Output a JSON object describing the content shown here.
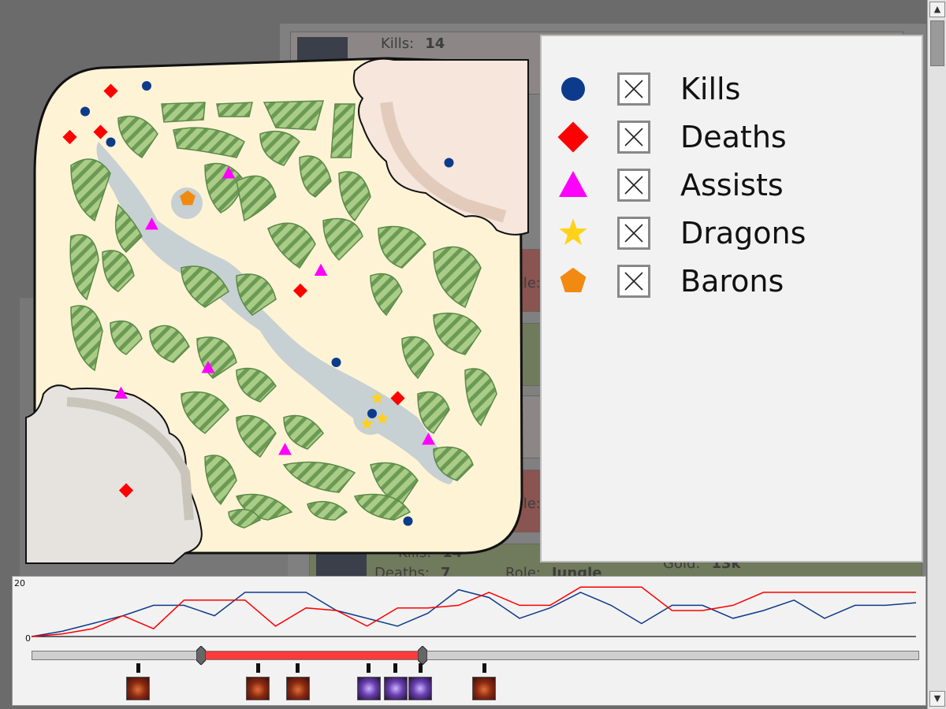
{
  "background_cards": [
    {
      "kills_label": "Kills:",
      "kills": "14",
      "deaths_label": "Deaths:",
      "deaths": "7",
      "role_label": "Role:",
      "role": "Jungle",
      "gold_label": "Gold:",
      "gold": "13k"
    }
  ],
  "legend": {
    "items": [
      {
        "label": "Kills",
        "symbol": "circle",
        "color": "#0d3b8c",
        "checked": true
      },
      {
        "label": "Deaths",
        "symbol": "diamond",
        "color": "#ff0000",
        "checked": true
      },
      {
        "label": "Assists",
        "symbol": "triangle",
        "color": "#ff00ff",
        "checked": true
      },
      {
        "label": "Dragons",
        "symbol": "star",
        "color": "#ffd21a",
        "checked": true
      },
      {
        "label": "Barons",
        "symbol": "pentagon",
        "color": "#f28a12",
        "checked": true
      }
    ]
  },
  "timeline": {
    "y_max_label": "20",
    "y_min_label": "0",
    "range_start": 0.19,
    "range_end": 0.44,
    "events": [
      {
        "type": "fire",
        "position": 0.12
      },
      {
        "type": "fire",
        "position": 0.255
      },
      {
        "type": "fire",
        "position": 0.3
      },
      {
        "type": "void",
        "position": 0.38
      },
      {
        "type": "void",
        "position": 0.41
      },
      {
        "type": "void",
        "position": 0.438
      },
      {
        "type": "fire",
        "position": 0.51
      }
    ]
  },
  "chart_data": {
    "type": "line",
    "ylim": [
      0,
      20
    ],
    "x": [
      0,
      1,
      2,
      3,
      4,
      5,
      6,
      7,
      8,
      9,
      10,
      11,
      12,
      13,
      14,
      15,
      16,
      17,
      18,
      19,
      20,
      21,
      22,
      23,
      24,
      25,
      26,
      27,
      28,
      29
    ],
    "series": [
      {
        "color": "#0d3b8c",
        "values": [
          0,
          2,
          5,
          8,
          12,
          12,
          8,
          17,
          17,
          17,
          10,
          7,
          4,
          9,
          18,
          15,
          7,
          11,
          17,
          12,
          5,
          12,
          12,
          7,
          10,
          14,
          7,
          12,
          12,
          13
        ]
      },
      {
        "color": "#ff0000",
        "values": [
          0,
          1,
          3,
          8,
          3,
          14,
          14,
          14,
          4,
          11,
          10,
          4,
          11,
          11,
          12,
          17,
          12,
          12,
          19,
          19,
          19,
          10,
          10,
          12,
          17,
          17,
          17,
          17,
          17,
          17
        ]
      }
    ]
  },
  "colors": {
    "map_ground": "#fff3d6",
    "jungle": "#a9cc86",
    "jungle_hatch": "#6b9a55",
    "river": "#c7d0d3",
    "base_top": "#f6e6dc",
    "base_bottom": "#e6e3df",
    "range": "#ff3a3a"
  },
  "map_markers": {
    "kills": [
      [
        0.24,
        0.06
      ],
      [
        0.12,
        0.11
      ],
      [
        0.17,
        0.17
      ],
      [
        0.83,
        0.21
      ],
      [
        0.61,
        0.6
      ],
      [
        0.68,
        0.7
      ],
      [
        0.75,
        0.91
      ]
    ],
    "deaths": [
      [
        0.17,
        0.07
      ],
      [
        0.09,
        0.16
      ],
      [
        0.15,
        0.15
      ],
      [
        0.54,
        0.46
      ],
      [
        0.73,
        0.67
      ],
      [
        0.2,
        0.85
      ]
    ],
    "assists": [
      [
        0.4,
        0.23
      ],
      [
        0.25,
        0.33
      ],
      [
        0.58,
        0.42
      ],
      [
        0.36,
        0.61
      ],
      [
        0.19,
        0.66
      ],
      [
        0.51,
        0.77
      ],
      [
        0.79,
        0.75
      ]
    ],
    "dragons": [
      [
        0.69,
        0.67
      ],
      [
        0.67,
        0.72
      ],
      [
        0.7,
        0.71
      ]
    ],
    "barons": [
      [
        0.32,
        0.28
      ]
    ]
  }
}
